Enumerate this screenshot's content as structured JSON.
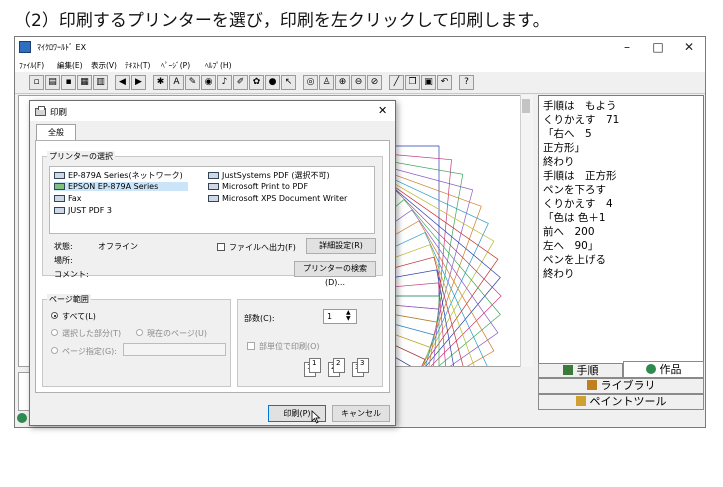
{
  "caption": "（2）印刷するプリンターを選び，印刷を左クリックして印刷します。",
  "app": {
    "title": "ﾏｲｸﾛﾜｰﾙﾄﾞ EX",
    "window_controls": {
      "minimize": "–",
      "maximize": "□",
      "close": "✕"
    },
    "menu": [
      "ﾌｧｲﾙ(F)",
      "編集(E)",
      "表示(V)",
      "ﾃｷｽﾄ(T)",
      "ﾍﾟｰｼﾞ(P)",
      "ﾍﾙﾌﾟ(H)"
    ],
    "toolbar_icons": [
      "new-icon",
      "open-icon",
      "save-icon",
      "print-icon",
      "grid-icon",
      "back-icon",
      "forward-icon",
      "turtle-icon",
      "text-icon",
      "pen-icon",
      "eye-icon",
      "music-icon",
      "brush-icon",
      "color-icon",
      "globe-icon",
      "cursor-icon",
      "view-icon",
      "person-icon",
      "zoom-in-icon",
      "zoom-out-icon",
      "stop-icon",
      "line-icon",
      "copy-icon",
      "paste-icon",
      "undo-icon",
      "help-icon"
    ],
    "program_lines": [
      "手順は　もよう",
      "くりかえす　71",
      "「右へ　5",
      "正方形」",
      "終わり",
      "手順は　正方形",
      "ペンを下ろす",
      "くりかえす　4",
      "「色は 色＋1",
      "前へ　200",
      "左へ　90」",
      "ペンを上げる",
      "終わり"
    ],
    "tabs": {
      "steps": "手順",
      "works": "作品",
      "library": "ライブラリ",
      "paint_tool": "ペイントツール"
    }
  },
  "print_dialog": {
    "title": "印刷",
    "close": "✕",
    "tab_general": "全般",
    "printer_select_label": "プリンターの選択",
    "printers_left": [
      "EP-879A Series(ネットワーク)",
      "EPSON EP-879A Series",
      "Fax",
      "JUST PDF 3"
    ],
    "printers_right": [
      "JustSystems PDF (選択不可)",
      "Microsoft Print to PDF",
      "Microsoft XPS Document Writer"
    ],
    "selected_printer": "EPSON EP-879A Series",
    "status_label": "状態:",
    "status_value": "オフライン",
    "location_label": "場所:",
    "comment_label": "コメント:",
    "print_to_file": "ファイルへ出力(F)",
    "preferences_button": "詳細設定(R)",
    "find_printer_button": "プリンターの検索(D)...",
    "page_range_label": "ページ範囲",
    "range_all": "すべて(L)",
    "range_selection": "選択した部分(T)",
    "range_current": "現在のページ(U)",
    "range_pages": "ページ指定(G):",
    "copies_label": "部数(C):",
    "copies_value": "1",
    "collate_label": "部単位で印刷(O)",
    "collate_pages": [
      "1",
      "1",
      "2",
      "2",
      "3",
      "3"
    ],
    "print_button": "印刷(P)",
    "cancel_button": "キャンセル"
  },
  "colors": {
    "accent": "#0078d7",
    "selection": "#cce4f7",
    "window_bg": "#f0f0f0"
  }
}
